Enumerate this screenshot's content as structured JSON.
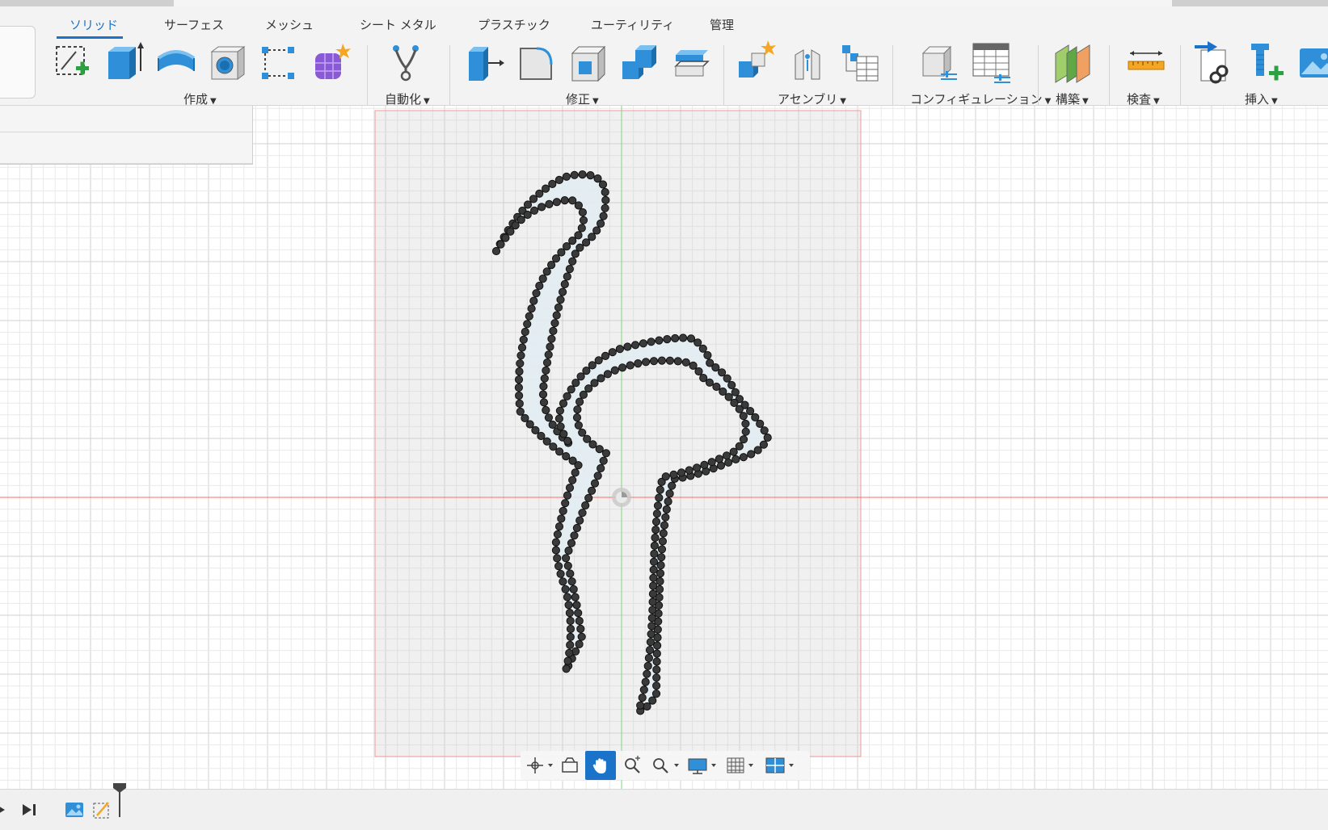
{
  "tabs": [
    {
      "label": "ソリッド",
      "active": true
    },
    {
      "label": "サーフェス",
      "active": false
    },
    {
      "label": "メッシュ",
      "active": false
    },
    {
      "label": "シート メタル",
      "active": false
    },
    {
      "label": "プラスチック",
      "active": false
    },
    {
      "label": "ユーティリティ",
      "active": false
    },
    {
      "label": "管理",
      "active": false
    }
  ],
  "groups": {
    "create": "作成",
    "automate": "自動化",
    "modify": "修正",
    "assemble": "アセンブリ",
    "configure": "コンフィギュレーション",
    "construct": "構築",
    "inspect": "検査",
    "insert": "挿入"
  },
  "tools": {
    "create": [
      "create-sketch-icon",
      "extrude-icon",
      "revolve-icon",
      "hole-icon",
      "pattern-icon",
      "form-icon"
    ],
    "automate": [
      "automate-icon"
    ],
    "modify": [
      "press-pull-icon",
      "fillet-icon",
      "shell-icon",
      "combine-icon",
      "offset-face-icon"
    ],
    "assemble": [
      "new-component-icon",
      "joint-icon",
      "bom-icon"
    ],
    "configure": [
      "configure-icon",
      "config-table-icon"
    ],
    "construct": [
      "construct-plane-icon"
    ],
    "inspect": [
      "measure-icon"
    ],
    "insert": [
      "insert-derive-icon",
      "insert-mcmaster-icon",
      "insert-canvas-icon"
    ]
  },
  "navbar": [
    "orbit-icon",
    "look-at-icon",
    "pan-icon",
    "zoom-icon",
    "fit-icon",
    "display-settings-icon",
    "grid-settings-icon",
    "viewports-icon"
  ],
  "timeline": [
    "play-icon",
    "step-end-icon",
    "canvas-feature-icon",
    "sketch-feature-icon"
  ],
  "colors": {
    "accent": "#1a73c9",
    "x_axis": "#ff6b6b",
    "y_axis": "#7ed67e",
    "grid_minor": "#e9e9e9",
    "grid_major": "#d2d2d2",
    "sketch_profile": "#e3edf3",
    "sketch_line": "#5aa9d6",
    "spline_point": "#3a3a3a"
  }
}
